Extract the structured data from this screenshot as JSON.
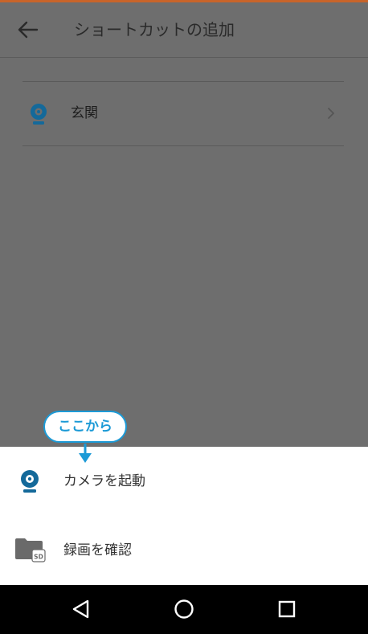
{
  "header": {
    "title": "ショートカットの追加"
  },
  "list": {
    "items": [
      {
        "label": "玄関"
      }
    ]
  },
  "callout": {
    "text": "ここから"
  },
  "sheet": {
    "items": [
      {
        "label": "カメラを起動",
        "icon": "camera-icon"
      },
      {
        "label": "録画を確認",
        "icon": "sd-folder-icon",
        "badge": "SD"
      }
    ]
  },
  "navbar": {
    "buttons": [
      "back-triangle-icon",
      "home-circle-icon",
      "recents-square-icon"
    ]
  },
  "colors": {
    "accent": "#c8642a",
    "camera_blue": "#14699a",
    "callout_blue": "#1c9ad6",
    "dim_background": "#6e6e6e"
  }
}
